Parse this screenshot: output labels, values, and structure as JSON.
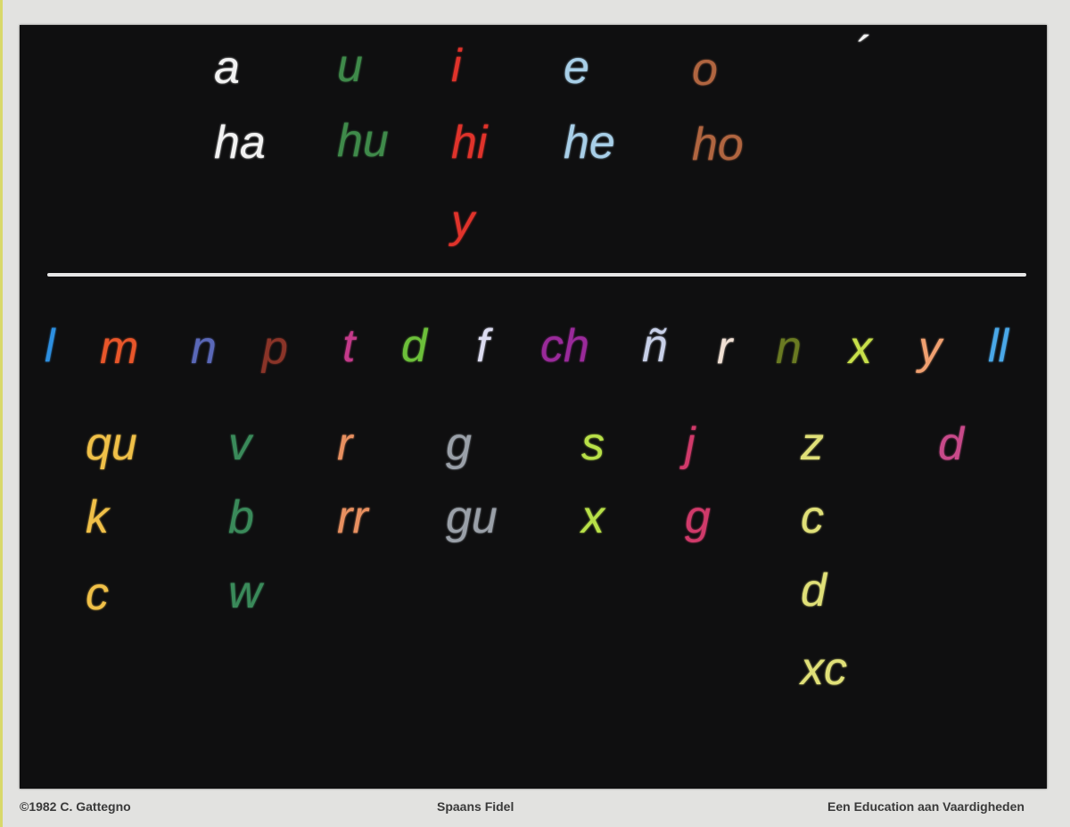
{
  "colors": {
    "board": "#0f0f10",
    "a": "#f2f2f2",
    "u": "#3f8a4a",
    "i": "#e0332b",
    "e": "#a8cfe8",
    "o": "#b06540",
    "l": "#2d8fe0",
    "m": "#e8562a",
    "n1": "#5a68b8",
    "p": "#8a3428",
    "t": "#c43a8a",
    "d": "#6cbf3a",
    "f": "#dcdcf0",
    "ch": "#9a2a9a",
    "ntilde": "#c8d0e8",
    "r": "#f0e0d4",
    "n2": "#6a7a22",
    "x": "#c8e04a",
    "y": "#f0a070",
    "ll": "#4aa8e8",
    "qu": "#f0c048",
    "v": "#3a8a5a",
    "rr": "#e89060",
    "g": "#9aa0a8",
    "s": "#b8e048",
    "j": "#d03a6a",
    "z": "#e0e078",
    "dd": "#c84a8a"
  },
  "vowels": {
    "a": [
      "a",
      "ha"
    ],
    "u": [
      "u",
      "hu"
    ],
    "i": [
      "i",
      "hi",
      "y"
    ],
    "e": [
      "e",
      "he"
    ],
    "o": [
      "o",
      "ho"
    ],
    "accent": "´"
  },
  "consonant_row": [
    "l",
    "m",
    "n",
    "p",
    "t",
    "d",
    "f",
    "ch",
    "ñ",
    "r",
    "n",
    "x",
    "y",
    "ll"
  ],
  "columns": {
    "k": [
      "qu",
      "k",
      "c"
    ],
    "b": [
      "v",
      "b",
      "w"
    ],
    "rr": [
      "r",
      "rr"
    ],
    "g": [
      "g",
      "gu"
    ],
    "s": [
      "s",
      "x"
    ],
    "j": [
      "j",
      "g"
    ],
    "z": [
      "z",
      "c",
      "d",
      "xc"
    ],
    "d": [
      "d"
    ]
  },
  "footer": {
    "left": "©1982 C. Gattegno",
    "center": "Spaans Fidel",
    "right": "Een Education aan Vaardigheden"
  }
}
